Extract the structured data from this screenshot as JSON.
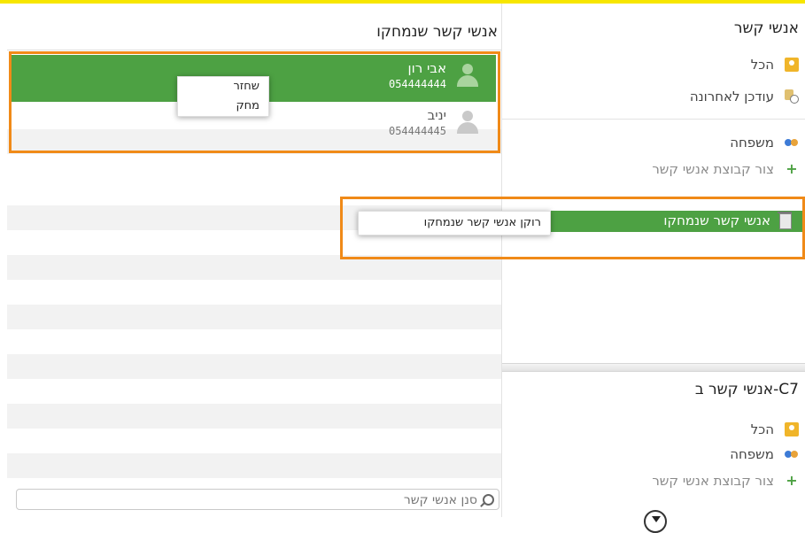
{
  "sidebar": {
    "title": "אנשי קשר",
    "items": [
      {
        "label": "הכל",
        "icon": "contacts-icon"
      },
      {
        "label": "עודכן לאחרונה",
        "icon": "recent-icon"
      }
    ],
    "groups": [
      {
        "label": "משפחה",
        "icon": "group-icon"
      }
    ],
    "create_group": "צור קבוצת אנשי קשר",
    "trash": {
      "label": "אנשי קשר שנמחקו",
      "icon": "trash-icon"
    },
    "section2_title": "אנשי קשר ב-C7",
    "section2_items": [
      {
        "label": "הכל",
        "icon": "contacts-icon"
      },
      {
        "label": "משפחה",
        "icon": "group-icon"
      }
    ],
    "section2_create": "צור קבוצת אנשי קשר"
  },
  "main": {
    "title": "אנשי קשר שנמחקו",
    "contacts": [
      {
        "name": "אבי רון",
        "phone": "054444444",
        "selected": true
      },
      {
        "name": "יניב",
        "phone": "054444445",
        "selected": false
      }
    ],
    "context_menu": [
      "שחזר",
      "מחק"
    ],
    "search_placeholder": "סנן אנשי קשר"
  },
  "trash_context_menu": [
    "רוקן אנשי קשר שנמחקו"
  ],
  "colors": {
    "accent_green": "#4da143",
    "highlight_orange": "#f08a18",
    "top_bar": "#f7e600"
  }
}
